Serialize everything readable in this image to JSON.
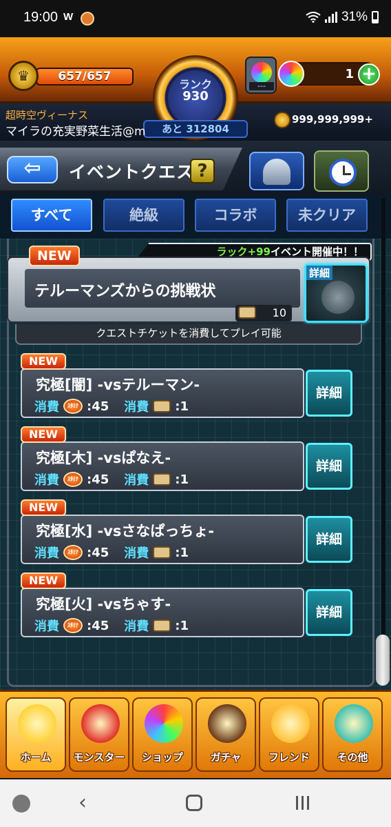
{
  "status_bar": {
    "time": "19:00",
    "app_indicator": "W",
    "battery": "31%"
  },
  "header": {
    "stamina": "657/657",
    "stamina_fraction": 1.0,
    "rank_label": "ランク",
    "rank_value": "930",
    "rank_next": "あと 312804",
    "orb_box_label": "---",
    "orb_count": "1",
    "plus_label": "+",
    "event_name": "超時空ヴィーナス",
    "username": "マイラの充実野菜生活@m",
    "coins": "999,999,999+",
    "stamina_medal": "♛"
  },
  "title_bar": {
    "back_label": "⇦",
    "title": "イベントクエスト",
    "help_label": "?"
  },
  "tabs": [
    {
      "label": "すべて",
      "active": true
    },
    {
      "label": "絶級",
      "active": false
    },
    {
      "label": "コラボ",
      "active": false
    },
    {
      "label": "未クリア",
      "active": false
    }
  ],
  "event": {
    "new_label": "NEW",
    "banner_green": "ラック+99",
    "banner_rest": "イベント開催中！！",
    "title": "テルーマンズからの挑戦状",
    "ticket_count": "10",
    "detail_label": "詳細",
    "note": "クエストチケットを消費してプレイ可能"
  },
  "quests": [
    {
      "new_label": "NEW",
      "name": "究極[闇] -vsテルーマン-",
      "cost_label": "消費",
      "stamina_icon_text": "ｽﾀﾐﾅ",
      "stamina_cost": ":45",
      "ticket_label": "消費",
      "ticket_cost": ":1",
      "detail_label": "詳細"
    },
    {
      "new_label": "NEW",
      "name": "究極[木] -vsぱなえ-",
      "cost_label": "消費",
      "stamina_icon_text": "ｽﾀﾐﾅ",
      "stamina_cost": ":45",
      "ticket_label": "消費",
      "ticket_cost": ":1",
      "detail_label": "詳細"
    },
    {
      "new_label": "NEW",
      "name": "究極[水] -vsさなぱっちょ-",
      "cost_label": "消費",
      "stamina_icon_text": "ｽﾀﾐﾅ",
      "stamina_cost": ":45",
      "ticket_label": "消費",
      "ticket_cost": ":1",
      "detail_label": "詳細"
    },
    {
      "new_label": "NEW",
      "name": "究極[火] -vsちゃす-",
      "cost_label": "消費",
      "stamina_icon_text": "ｽﾀﾐﾅ",
      "stamina_cost": ":45",
      "ticket_label": "消費",
      "ticket_cost": ":1",
      "detail_label": "詳細"
    }
  ],
  "bottom_nav": [
    {
      "label": "ホーム",
      "icon": "home-gate-icon",
      "color": "#ffd23a",
      "active": true
    },
    {
      "label": "モンスター",
      "icon": "monster-icon",
      "color": "#e0302a",
      "active": false
    },
    {
      "label": "ショップ",
      "icon": "rainbow-orb-icon",
      "color": "#9a50ff",
      "active": false
    },
    {
      "label": "ガチャ",
      "icon": "gacha-character-icon",
      "color": "#6a3a1a",
      "active": false
    },
    {
      "label": "フレンド",
      "icon": "friends-icon",
      "color": "#ffc23a",
      "active": false
    },
    {
      "label": "その他",
      "icon": "other-menu-icon",
      "color": "#40c0b0",
      "active": false
    }
  ],
  "android_nav": {
    "back": "‹"
  }
}
